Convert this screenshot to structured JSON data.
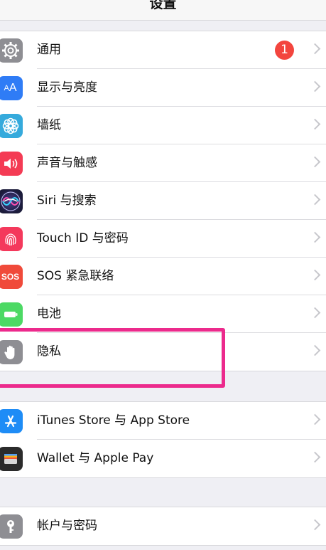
{
  "nav": {
    "title": "设置"
  },
  "group1": [
    {
      "name": "general",
      "label": "通用",
      "icon": "gear-icon",
      "color": "#8e8e93",
      "badge": "1"
    },
    {
      "name": "display",
      "label": "显示与亮度",
      "icon": "text-size-icon",
      "color": "#2f7cf6"
    },
    {
      "name": "wallpaper",
      "label": "墙纸",
      "icon": "flower-icon",
      "color": "#35aadc"
    },
    {
      "name": "sounds",
      "label": "声音与触感",
      "icon": "speaker-icon",
      "color": "#f43b54"
    },
    {
      "name": "siri",
      "label": "Siri 与搜索",
      "icon": "siri-icon",
      "color": "#1b1b3a"
    },
    {
      "name": "touch-id",
      "label": "Touch ID 与密码",
      "icon": "fingerprint-icon",
      "color": "#f4395c"
    },
    {
      "name": "sos",
      "label": "SOS 紧急联络",
      "icon": "sos-icon",
      "color": "#f04a3a",
      "icon_text": "SOS"
    },
    {
      "name": "battery",
      "label": "电池",
      "icon": "battery-icon",
      "color": "#4cd964"
    },
    {
      "name": "privacy",
      "label": "隐私",
      "icon": "hand-icon",
      "color": "#8e8e93"
    }
  ],
  "group2": [
    {
      "name": "app-store",
      "label": "iTunes Store 与 App Store",
      "icon": "app-store-icon",
      "color": "#1e8cf6"
    },
    {
      "name": "wallet",
      "label": "Wallet 与 Apple Pay",
      "icon": "wallet-icon",
      "color": "#2b2b2b"
    }
  ],
  "group3": [
    {
      "name": "accounts",
      "label": "帐户与密码",
      "icon": "key-icon",
      "color": "#8e8e93"
    }
  ],
  "highlight_color": "#ec2a8c"
}
